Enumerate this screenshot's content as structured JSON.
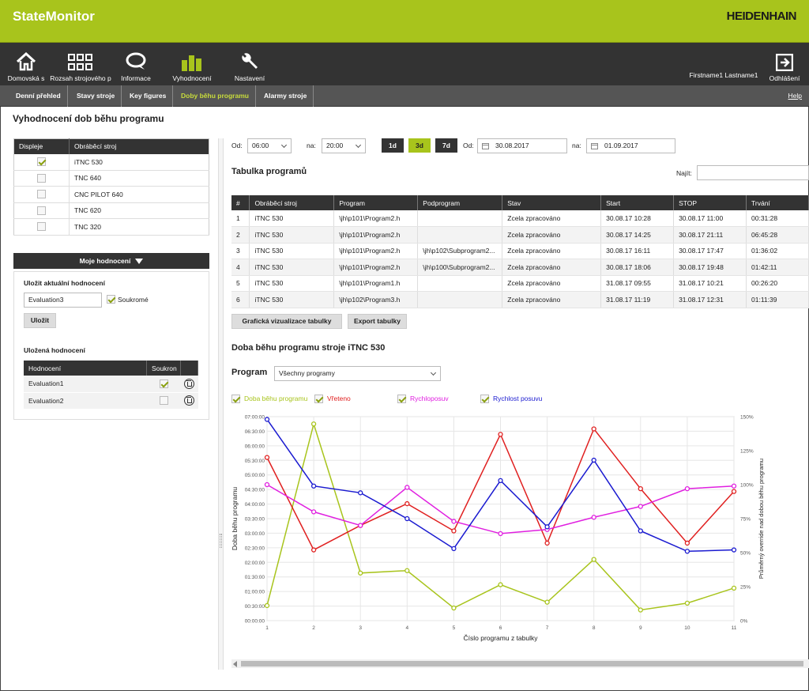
{
  "app": {
    "title": "StateMonitor",
    "brand": "HEIDENHAIN"
  },
  "nav": {
    "items": [
      {
        "label": "Domovská s",
        "icon": "home-icon"
      },
      {
        "label": "Rozsah strojového p",
        "icon": "grid-icon"
      },
      {
        "label": "Informace",
        "icon": "chat-bubble-icon"
      },
      {
        "label": "Vyhodnocení",
        "icon": "bar-chart-icon"
      },
      {
        "label": "Nastavení",
        "icon": "wrench-icon"
      }
    ],
    "user": "Firstname1 Lastname1",
    "logout": "Odhlášení"
  },
  "subnav": {
    "items": [
      "Denní přehled",
      "Stavy stroje",
      "Key figures",
      "Doby běhu programu",
      "Alarmy stroje"
    ],
    "active": "Doby běhu programu",
    "help": "Help"
  },
  "page": {
    "title": "Vyhodnocení dob běhu programu"
  },
  "machines": {
    "headers": [
      "Displeje",
      "Obráběcí stroj"
    ],
    "rows": [
      {
        "checked": true,
        "name": "iTNC 530"
      },
      {
        "checked": false,
        "name": "TNC 640"
      },
      {
        "checked": false,
        "name": "CNC PILOT 640"
      },
      {
        "checked": false,
        "name": "TNC 620"
      },
      {
        "checked": false,
        "name": "TNC 320"
      }
    ]
  },
  "evaluations": {
    "header": "Moje hodnocení",
    "save_current_label": "Uložit aktuální hodnocení",
    "name_value": "Evaluation3",
    "private_label": "Soukromé",
    "private_checked": true,
    "save_button": "Uložit",
    "saved_label": "Uložená hodnocení",
    "saved_headers": [
      "Hodnocení",
      "Soukron"
    ],
    "saved_rows": [
      {
        "name": "Evaluation1",
        "private": true
      },
      {
        "name": "Evaluation2",
        "private": false
      }
    ]
  },
  "filters": {
    "from_label": "Od:",
    "from_time": "06:00",
    "to_label": "na:",
    "to_time": "20:00",
    "day_buttons": [
      "1d",
      "3d",
      "7d"
    ],
    "active_day": "3d",
    "date_from_label": "Od:",
    "date_from": "30.08.2017",
    "date_to_label": "na:",
    "date_to": "01.09.2017"
  },
  "program_table": {
    "title": "Tabulka programů",
    "search_label": "Najít:",
    "search_value": "",
    "headers": [
      "#",
      "Obráběcí stroj",
      "Program",
      "Podprogram",
      "Stav",
      "Start",
      "STOP",
      "Trvání"
    ],
    "rows": [
      [
        "1",
        "iTNC 530",
        "\\jh\\p101\\Program2.h",
        "",
        "Zcela zpracováno",
        "30.08.17 10:28",
        "30.08.17 11:00",
        "00:31:28"
      ],
      [
        "2",
        "iTNC 530",
        "\\jh\\p101\\Program2.h",
        "",
        "Zcela zpracováno",
        "30.08.17 14:25",
        "30.08.17 21:11",
        "06:45:28"
      ],
      [
        "3",
        "iTNC 530",
        "\\jh\\p101\\Program2.h",
        "\\jh\\p102\\Subprogram2...",
        "Zcela zpracováno",
        "30.08.17 16:11",
        "30.08.17 17:47",
        "01:36:02"
      ],
      [
        "4",
        "iTNC 530",
        "\\jh\\p101\\Program2.h",
        "\\jh\\p100\\Subprogram2...",
        "Zcela zpracováno",
        "30.08.17 18:06",
        "30.08.17 19:48",
        "01:42:11"
      ],
      [
        "5",
        "iTNC 530",
        "\\jh\\p101\\Program1.h",
        "",
        "Zcela zpracováno",
        "31.08.17 09:55",
        "31.08.17 10:21",
        "00:26:20"
      ],
      [
        "6",
        "iTNC 530",
        "\\jh\\p102\\Program3.h",
        "",
        "Zcela zpracováno",
        "31.08.17 11:19",
        "31.08.17 12:31",
        "01:11:39"
      ]
    ],
    "btn_visualize": "Grafická vizualizace tabulky",
    "btn_export": "Export tabulky"
  },
  "chart_section": {
    "title": "Doba běhu programu stroje iTNC 530",
    "program_label": "Program",
    "program_value": "Všechny programy"
  },
  "chart_data": {
    "type": "line",
    "xlabel": "Číslo programu z tabulky",
    "ylabel": "Doba běhu programu",
    "y2label": "Průměrný override nad dobou běhu programu",
    "x": [
      1,
      2,
      3,
      4,
      5,
      6,
      7,
      8,
      9,
      10,
      11
    ],
    "y_ticks": [
      "00:00:00",
      "00:30:00",
      "01:00:00",
      "01:30:00",
      "02:00:00",
      "02:30:00",
      "03:00:00",
      "03:30:00",
      "04:00:00",
      "04:30:00",
      "05:00:00",
      "05:30:00",
      "06:00:00",
      "06:30:00",
      "07:00:00"
    ],
    "y2_ticks": [
      "0%",
      "25%",
      "50%",
      "75%",
      "100%",
      "125%",
      "150%"
    ],
    "ylim_minutes": [
      0,
      420
    ],
    "y2lim_percent": [
      0,
      150
    ],
    "series": [
      {
        "name": "Doba běhu programu",
        "axis": "left",
        "unit": "minutes",
        "color": "#a8c41c",
        "values": [
          31,
          405,
          98,
          103,
          26,
          74,
          38,
          126,
          22,
          36,
          67
        ]
      },
      {
        "name": "Vřeteno",
        "axis": "right",
        "unit": "percent",
        "color": "#e02020",
        "values": [
          120,
          52,
          70,
          86,
          66,
          137,
          57,
          141,
          97,
          57,
          95
        ]
      },
      {
        "name": "Rychloposuv",
        "axis": "right",
        "unit": "percent",
        "color": "#e020e0",
        "values": [
          100,
          80,
          70,
          98,
          73,
          64,
          67,
          76,
          84,
          97,
          99
        ]
      },
      {
        "name": "Rychlost posuvu",
        "axis": "right",
        "unit": "percent",
        "color": "#1a1ad0",
        "values": [
          148,
          99,
          94,
          75,
          53,
          103,
          69,
          118,
          66,
          51,
          52
        ]
      }
    ]
  }
}
